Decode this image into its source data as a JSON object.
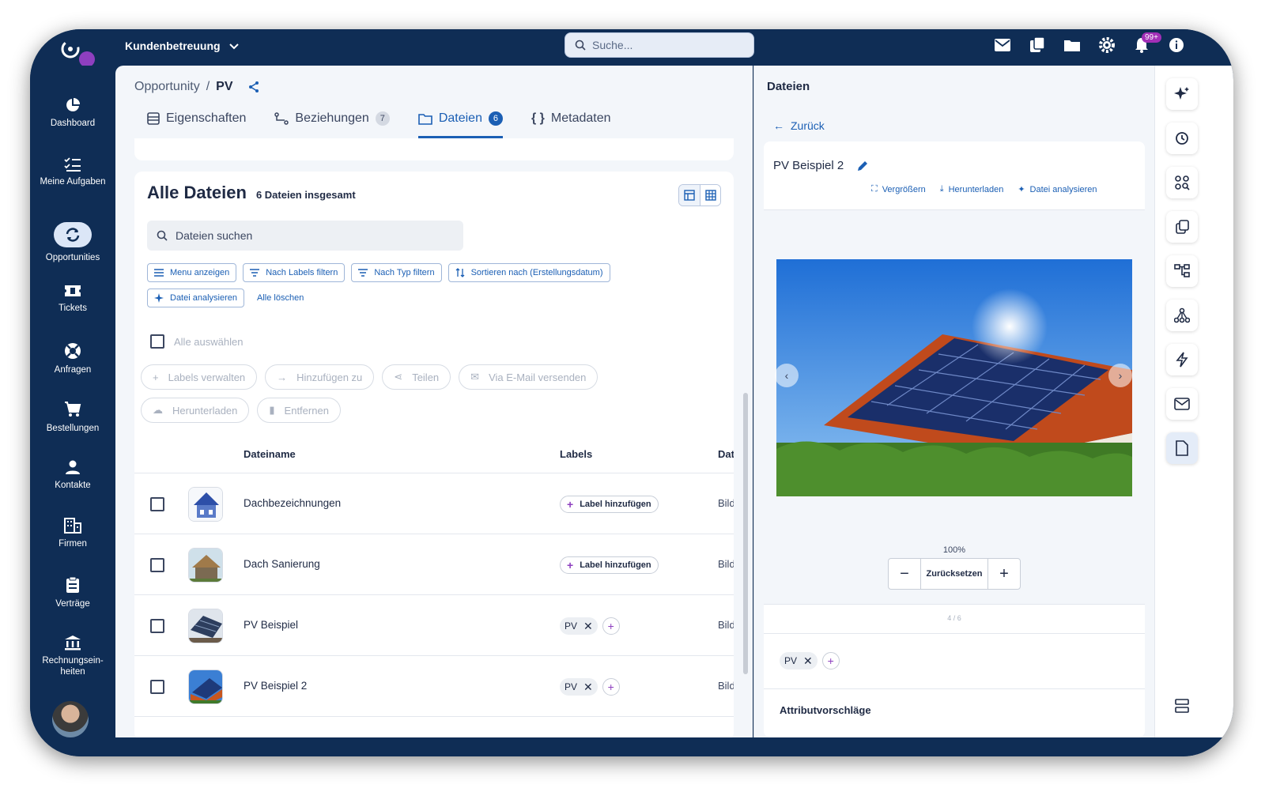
{
  "topbar": {
    "workspace": "Kundenbetreuung",
    "search_placeholder": "Suche...",
    "notification_count": "99+"
  },
  "sidebar": {
    "items": [
      {
        "label": "Dashboard",
        "icon": "pie-chart-icon"
      },
      {
        "label": "Meine Aufgaben",
        "icon": "checklist-icon"
      },
      {
        "label": "Opportunities",
        "icon": "sync-icon"
      },
      {
        "label": "Tickets",
        "icon": "ticket-icon"
      },
      {
        "label": "Anfragen",
        "icon": "lifebuoy-icon"
      },
      {
        "label": "Bestellungen",
        "icon": "cart-icon"
      },
      {
        "label": "Kontakte",
        "icon": "person-icon"
      },
      {
        "label": "Firmen",
        "icon": "building-icon"
      },
      {
        "label": "Verträge",
        "icon": "clipboard-icon"
      },
      {
        "label": "Rechnungsein-heiten",
        "icon": "bank-icon"
      }
    ]
  },
  "breadcrumb": {
    "parent": "Opportunity",
    "separator": "/",
    "current": "PV"
  },
  "tabs": [
    {
      "label": "Eigenschaften",
      "count": ""
    },
    {
      "label": "Beziehungen",
      "count": "7"
    },
    {
      "label": "Dateien",
      "count": "6"
    },
    {
      "label": "Metadaten",
      "count": ""
    }
  ],
  "files": {
    "title": "Alle Dateien",
    "subtitle": "6 Dateien insgesamt",
    "search_placeholder": "Dateien suchen",
    "filters": [
      "Menu anzeigen",
      "Nach Labels filtern",
      "Nach Typ filtern",
      "Sortieren nach (Erstellungsdatum)"
    ],
    "analyze": "Datei analysieren",
    "clear_all": "Alle löschen",
    "select_all": "Alle auswählen",
    "bulk_actions": [
      "Labels verwalten",
      "Hinzufügen zu",
      "Teilen",
      "Via E-Mail versenden",
      "Herunterladen",
      "Entfernen"
    ],
    "columns": {
      "name": "Dateiname",
      "labels": "Labels",
      "type": "Dat"
    },
    "label_add": "Label hinzufügen",
    "rows": [
      {
        "name": "Dachbezeichnungen",
        "label": "",
        "type": "Bild"
      },
      {
        "name": "Dach Sanierung",
        "label": "",
        "type": "Bild"
      },
      {
        "name": "PV Beispiel",
        "label": "PV",
        "type": "Bild"
      },
      {
        "name": "PV Beispiel 2",
        "label": "PV",
        "type": "Bild"
      }
    ]
  },
  "preview": {
    "panel_title": "Dateien",
    "back": "Zurück",
    "file_name": "PV Beispiel 2",
    "actions": [
      "Vergrößern",
      "Herunterladen",
      "Datei analysieren"
    ],
    "zoom": "100%",
    "reset": "Zurücksetzen",
    "pager": "4 / 6",
    "tag": "PV",
    "attributes_title": "Attributvorschläge"
  },
  "colors": {
    "brand_navy": "#0f2d55",
    "accent_blue": "#1b5fb4",
    "accent_purple": "#8e3fbf"
  }
}
